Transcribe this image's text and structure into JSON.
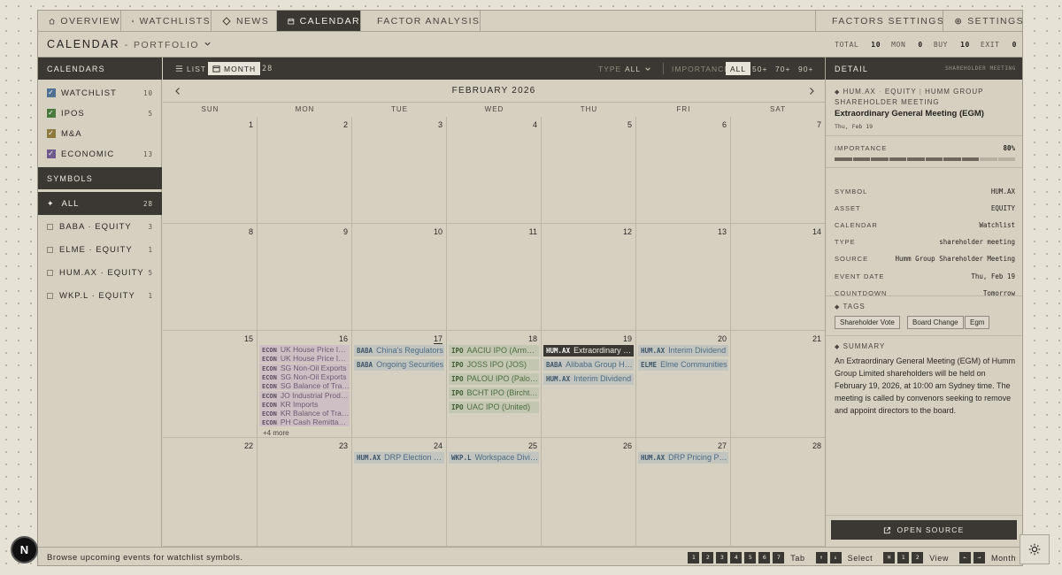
{
  "nav": {
    "tabs": [
      {
        "label": "OVERVIEW",
        "icon": "home-icon"
      },
      {
        "label": "WATCHLISTS",
        "icon": "grid-icon"
      },
      {
        "label": "NEWS",
        "icon": "diamond-icon"
      },
      {
        "label": "CALENDAR",
        "icon": "calendar-icon",
        "active": true
      },
      {
        "label": "FACTOR ANALYSIS",
        "icon": "bar-chart-icon"
      }
    ],
    "right_tabs": [
      {
        "label": "FACTORS SETTINGS",
        "icon": "sliders-icon"
      },
      {
        "label": "SETTINGS",
        "icon": "gear-icon"
      }
    ]
  },
  "header": {
    "title": "CALENDAR",
    "separator": "-",
    "subtitle": "PORTFOLIO",
    "stats": [
      {
        "label": "TOTAL",
        "value": "10"
      },
      {
        "label": "MON",
        "value": "0"
      },
      {
        "label": "BUY",
        "value": "10"
      },
      {
        "label": "EXIT",
        "value": "0"
      }
    ]
  },
  "sidebar": {
    "calendars_title": "CALENDARS",
    "calendars": [
      {
        "label": "WATCHLIST",
        "count": "10",
        "color": "#4f6f93",
        "checked": true
      },
      {
        "label": "IPOS",
        "count": "5",
        "color": "#4a7a3e",
        "checked": true
      },
      {
        "label": "M&A",
        "count": "",
        "color": "#8f7a3e",
        "checked": true
      },
      {
        "label": "ECONOMIC",
        "count": "13",
        "color": "#6e5a8c",
        "checked": true
      }
    ],
    "symbols_title": "SYMBOLS",
    "symbols": [
      {
        "label": "ALL",
        "count": "28",
        "active": true
      },
      {
        "label": "BABA · EQUITY",
        "count": "3"
      },
      {
        "label": "ELME · EQUITY",
        "count": "1"
      },
      {
        "label": "HUM.AX · EQUITY",
        "count": "5"
      },
      {
        "label": "WKP.L · EQUITY",
        "count": "1"
      }
    ]
  },
  "toolbar": {
    "list_label": "LIST",
    "month_label": "MONTH",
    "event_count": "28",
    "type_label": "TYPE",
    "type_value": "ALL",
    "importance_label": "IMPORTANCE",
    "importance_options": [
      "ALL",
      "50+",
      "70+",
      "90+"
    ]
  },
  "calendar": {
    "month_title": "FEBRUARY 2026",
    "weekdays": [
      "SUN",
      "MON",
      "TUE",
      "WED",
      "THU",
      "FRI",
      "SAT"
    ],
    "weeks": [
      [
        {
          "day": "1",
          "events": []
        },
        {
          "day": "2",
          "events": []
        },
        {
          "day": "3",
          "events": []
        },
        {
          "day": "4",
          "events": []
        },
        {
          "day": "5",
          "events": []
        },
        {
          "day": "6",
          "events": []
        },
        {
          "day": "7",
          "events": []
        }
      ],
      [
        {
          "day": "8",
          "events": []
        },
        {
          "day": "9",
          "events": []
        },
        {
          "day": "10",
          "events": []
        },
        {
          "day": "11",
          "events": []
        },
        {
          "day": "12",
          "events": []
        },
        {
          "day": "13",
          "events": []
        },
        {
          "day": "14",
          "events": []
        }
      ],
      [
        {
          "day": "15",
          "events": []
        },
        {
          "day": "16",
          "events": [
            {
              "sym": "ECON",
              "text": "UK House Price Index",
              "kind": "econ"
            },
            {
              "sym": "ECON",
              "text": "UK House Price Index",
              "kind": "econ"
            },
            {
              "sym": "ECON",
              "text": "SG Non-Oil Exports",
              "kind": "econ"
            },
            {
              "sym": "ECON",
              "text": "SG Non-Oil Exports",
              "kind": "econ"
            },
            {
              "sym": "ECON",
              "text": "SG Balance of Trade",
              "kind": "econ"
            },
            {
              "sym": "ECON",
              "text": "JO Industrial Production",
              "kind": "econ"
            },
            {
              "sym": "ECON",
              "text": "KR Imports",
              "kind": "econ"
            },
            {
              "sym": "ECON",
              "text": "KR Balance of Trade",
              "kind": "econ"
            },
            {
              "sym": "ECON",
              "text": "PH Cash Remittances",
              "kind": "econ"
            }
          ],
          "more": "+4 more"
        },
        {
          "day": "17",
          "today": true,
          "events": [
            {
              "sym": "BABA",
              "text": "China's Regulators",
              "kind": "blue"
            },
            {
              "sym": "BABA",
              "text": "Ongoing Securities",
              "kind": "blue"
            }
          ]
        },
        {
          "day": "18",
          "events": [
            {
              "sym": "IPO",
              "text": "AACIU IPO (Armada)",
              "kind": "green"
            },
            {
              "sym": "IPO",
              "text": "JOSS IPO (JOS)",
              "kind": "green"
            },
            {
              "sym": "IPO",
              "text": "PALOU IPO (Paloma)",
              "kind": "green"
            },
            {
              "sym": "IPO",
              "text": "BCHT IPO (Birchtech)",
              "kind": "green"
            },
            {
              "sym": "IPO",
              "text": "UAC IPO (United)",
              "kind": "green"
            }
          ]
        },
        {
          "day": "19",
          "events": [
            {
              "sym": "HUM.AX",
              "text": "Extraordinary General Meeting",
              "kind": "dark"
            },
            {
              "sym": "BABA",
              "text": "Alibaba Group Holding",
              "kind": "blue"
            },
            {
              "sym": "HUM.AX",
              "text": "Interim Dividend",
              "kind": "blue"
            }
          ]
        },
        {
          "day": "20",
          "events": [
            {
              "sym": "HUM.AX",
              "text": "Interim Dividend",
              "kind": "blue"
            },
            {
              "sym": "ELME",
              "text": "Elme Communities",
              "kind": "blue"
            }
          ]
        },
        {
          "day": "21",
          "events": []
        }
      ],
      [
        {
          "day": "22",
          "events": []
        },
        {
          "day": "23",
          "events": []
        },
        {
          "day": "24",
          "events": [
            {
              "sym": "HUM.AX",
              "text": "DRP Election Date",
              "kind": "blue"
            }
          ]
        },
        {
          "day": "25",
          "events": [
            {
              "sym": "WKP.L",
              "text": "Workspace Dividend",
              "kind": "blue"
            }
          ]
        },
        {
          "day": "26",
          "events": []
        },
        {
          "day": "27",
          "events": [
            {
              "sym": "HUM.AX",
              "text": "DRP Pricing Period",
              "kind": "blue"
            }
          ]
        },
        {
          "day": "28",
          "events": []
        }
      ]
    ]
  },
  "detail": {
    "title": "DETAIL",
    "subtitle": "SHAREHOLDER MEETING",
    "crumb_symbol": "HUM.AX",
    "crumb_asset": "EQUITY",
    "crumb_company": "HUMM GROUP",
    "crumb_type": "SHAREHOLDER MEETING",
    "event_title": "Extraordinary General Meeting (EGM)",
    "event_date": "Thu, Feb 19",
    "importance_label": "IMPORTANCE",
    "importance_value": "80%",
    "importance_fraction": 0.8,
    "fields": [
      {
        "k": "SYMBOL",
        "v": "HUM.AX"
      },
      {
        "k": "ASSET",
        "v": "EQUITY"
      },
      {
        "k": "CALENDAR",
        "v": "Watchlist"
      },
      {
        "k": "TYPE",
        "v": "shareholder meeting"
      },
      {
        "k": "SOURCE",
        "v": "Humm Group Shareholder Meeting"
      },
      {
        "k": "EVENT DATE",
        "v": "Thu, Feb 19"
      },
      {
        "k": "COUNTDOWN",
        "v": "Tomorrow"
      }
    ],
    "tags_label": "TAGS",
    "tags": [
      "Shareholder Vote",
      "Board Change",
      "Egm"
    ],
    "summary_label": "SUMMARY",
    "summary": "An Extraordinary General Meeting (EGM) of Humm Group Limited shareholders will be held on February 19, 2026, at 10:00 am Sydney time. The meeting is called by convenors seeking to remove and appoint directors to the board.",
    "open_source_label": "OPEN SOURCE"
  },
  "status": {
    "text": "Browse upcoming events for watchlist symbols.",
    "groups": [
      {
        "keys": [
          "1",
          "2",
          "3",
          "4",
          "5",
          "6",
          "7"
        ],
        "label": "Tab"
      },
      {
        "keys": [
          "↑",
          "↓"
        ],
        "label": "Select"
      },
      {
        "keys": [
          "⌘",
          "1",
          "2"
        ],
        "label": "View"
      },
      {
        "keys": [
          "←",
          "→"
        ],
        "label": "Month"
      }
    ]
  },
  "logo_letter": "N"
}
